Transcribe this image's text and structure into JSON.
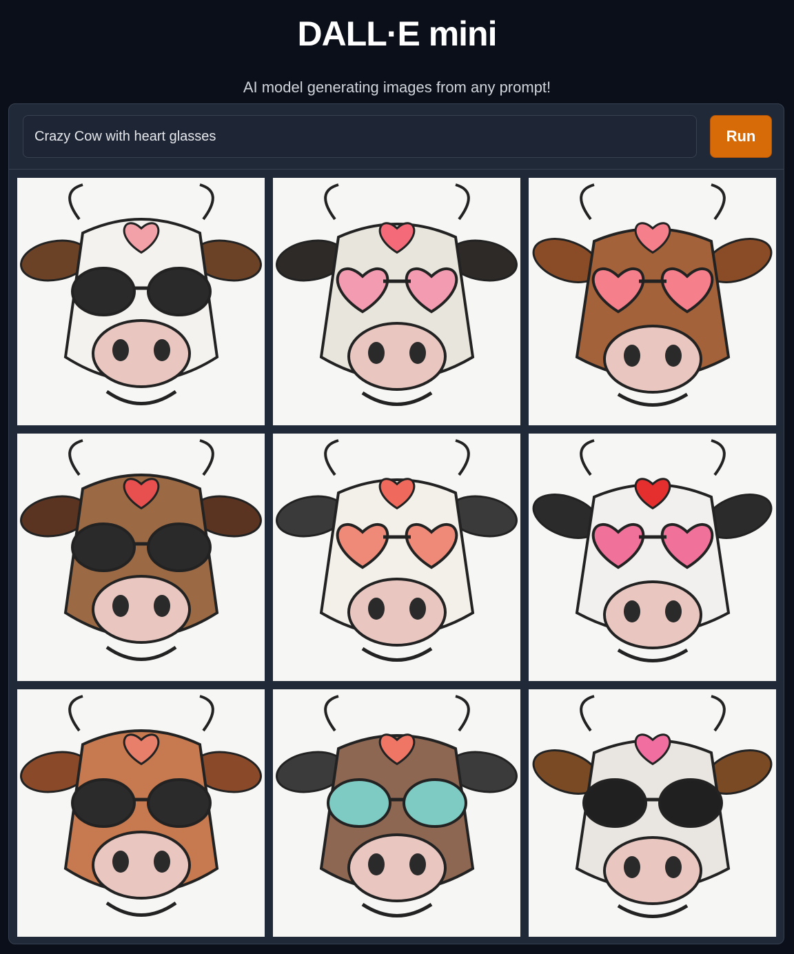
{
  "app": {
    "title": "DALL·E mini",
    "subtitle": "AI model generating images from any prompt!"
  },
  "prompt": {
    "value": "Crazy Cow with heart glasses",
    "placeholder": ""
  },
  "run_button": {
    "label": "Run"
  },
  "colors": {
    "background": "#0b0f19",
    "panel": "#1f2937",
    "accent": "#d66b07"
  },
  "gallery": {
    "images": [
      {
        "subject": "cow-heart-glasses-1",
        "coat": "#f4f2ee",
        "ear": "#6b4226",
        "heart": "#f2a1a8",
        "lens": "#2a2a2a"
      },
      {
        "subject": "cow-heart-glasses-2",
        "coat": "#e8e5dc",
        "ear": "#2e2a28",
        "heart": "#f46a78",
        "lens": "#f39bb0"
      },
      {
        "subject": "cow-heart-glasses-3",
        "coat": "#a4623a",
        "ear": "#8a4c27",
        "heart": "#f57f8a",
        "lens": "#f57f8a"
      },
      {
        "subject": "cow-heart-glasses-4",
        "coat": "#9b6a45",
        "ear": "#5a3420",
        "heart": "#e8504f",
        "lens": "#2a2a2a"
      },
      {
        "subject": "cow-heart-glasses-5",
        "coat": "#f3efe9",
        "ear": "#3a3a3a",
        "heart": "#ef6a5c",
        "lens": "#f08a78"
      },
      {
        "subject": "cow-heart-glasses-6",
        "coat": "#f2f0ee",
        "ear": "#2b2b2b",
        "heart": "#e52f2f",
        "lens": "#f0719a"
      },
      {
        "subject": "cow-heart-glasses-7",
        "coat": "#c77a4f",
        "ear": "#8a4a2a",
        "heart": "#e87f6a",
        "lens": "#2b2b2b"
      },
      {
        "subject": "cow-heart-glasses-8",
        "coat": "#8e6752",
        "ear": "#3b3b3b",
        "heart": "#ef7565",
        "lens": "#7ecbc3"
      },
      {
        "subject": "cow-heart-glasses-9",
        "coat": "#e9e5e0",
        "ear": "#7a4a25",
        "heart": "#f06fa0",
        "lens": "#202020"
      }
    ]
  }
}
